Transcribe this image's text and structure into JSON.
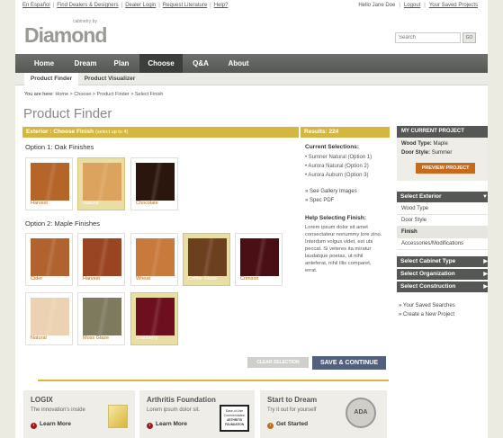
{
  "top_links": [
    "En Español",
    "Find Dealers & Designers",
    "Dealer Login",
    "Request Literature",
    "Help?"
  ],
  "user": {
    "greeting": "Hello Jane Doe",
    "logout": "Logout",
    "saved_projects": "Your Saved Projects"
  },
  "logo": {
    "name": "Diamond",
    "tagline": "cabinetry by"
  },
  "search": {
    "placeholder": "Search",
    "go": "GO"
  },
  "nav": {
    "items": [
      "Home",
      "Dream",
      "Plan",
      "Choose",
      "Q&A",
      "About"
    ],
    "active": "Choose"
  },
  "subnav": {
    "items": [
      "Product Finder",
      "Product Visualizer"
    ],
    "active": "Product Finder"
  },
  "breadcrumb": {
    "label": "You are here:",
    "path": "Home > Choose > Product Finder > Select Finish"
  },
  "page_title": "Product Finder",
  "step_bar": {
    "title": "Exterior : Choose Finish",
    "note": "(select up to 4)"
  },
  "results": "Results: 224",
  "option1": {
    "title": "Option 1: Oak Finishes",
    "swatches": [
      {
        "label": "Harvest",
        "color": "#b5642a",
        "selected": false
      },
      {
        "label": "Natural",
        "color": "#dba35d",
        "selected": true
      },
      {
        "label": "Chocolate",
        "color": "#2b160d",
        "selected": false
      }
    ]
  },
  "option2": {
    "title": "Option 2: Maple Finishes",
    "swatches": [
      {
        "label": "Cider",
        "color": "#b0622f",
        "selected": false
      },
      {
        "label": "Harvest",
        "color": "#9a4522",
        "selected": false
      },
      {
        "label": "Wheat",
        "color": "#c8793c",
        "selected": false
      },
      {
        "label": "Coffee Glaze",
        "color": "#6c3f1f",
        "selected": true
      },
      {
        "label": "Crimson",
        "color": "#4a0f14",
        "selected": false
      },
      {
        "label": "Natural",
        "color": "#ecd2b2",
        "selected": false
      },
      {
        "label": "Moss Glaze",
        "color": "#7d7a5e",
        "selected": false
      },
      {
        "label": "Cranberry",
        "color": "#6e0f20",
        "selected": true
      }
    ]
  },
  "current_selections": {
    "heading": "Current Selections:",
    "items": [
      "• Sumner Natural (Option 1)",
      "• Aurora Natural (Option 2)",
      "• Aurora Auburn (Option 3)"
    ]
  },
  "links": {
    "gallery": "» See Gallery Images",
    "spec": "» Spec PDF"
  },
  "help": {
    "heading": "Help Selecting Finish:",
    "text": "Lorem ipsum dolor sit amet consectateur nonummy lore zino. Interdum volgus videt, est ubi peccat. Si veteres ita miratur laudatque poetas, ut nihil anteferat, nihil illis comparet, errat."
  },
  "buttons": {
    "clear": "CLEAR SELECTION",
    "save": "SAVE & CONTINUE"
  },
  "promos": [
    {
      "title": "LOGIX",
      "sub": "The innovation's inside",
      "link": "Learn More"
    },
    {
      "title": "Arthritis Foundation",
      "sub": "Lorem ipsum dolor sit.",
      "link": "Learn More"
    },
    {
      "title": "Start to Dream",
      "sub": "Try it out for yourself",
      "link": "Get Started"
    }
  ],
  "badge_text": {
    "ease": "Ease-of-Use Commendation",
    "arthritis": "ARTHRITIS FOUNDATION",
    "ada": "ADA"
  },
  "project": {
    "heading": "MY CURRENT PROJECT",
    "wood_type_label": "Wood Type:",
    "wood_type": "Maple",
    "door_style_label": "Door Style:",
    "door_style": "Summer",
    "preview": "PREVIEW PROJECT"
  },
  "accordion": {
    "select_exterior": "Select Exterior",
    "exterior_items": [
      "Wood Type",
      "Door Style",
      "Finish",
      "Accessories/Modifications"
    ],
    "exterior_active": "Finish",
    "others": [
      "Select Cabinet Type",
      "Select Organization",
      "Select Construction"
    ]
  },
  "side_links": [
    "» Your Saved Searches",
    "» Create a New Project"
  ]
}
